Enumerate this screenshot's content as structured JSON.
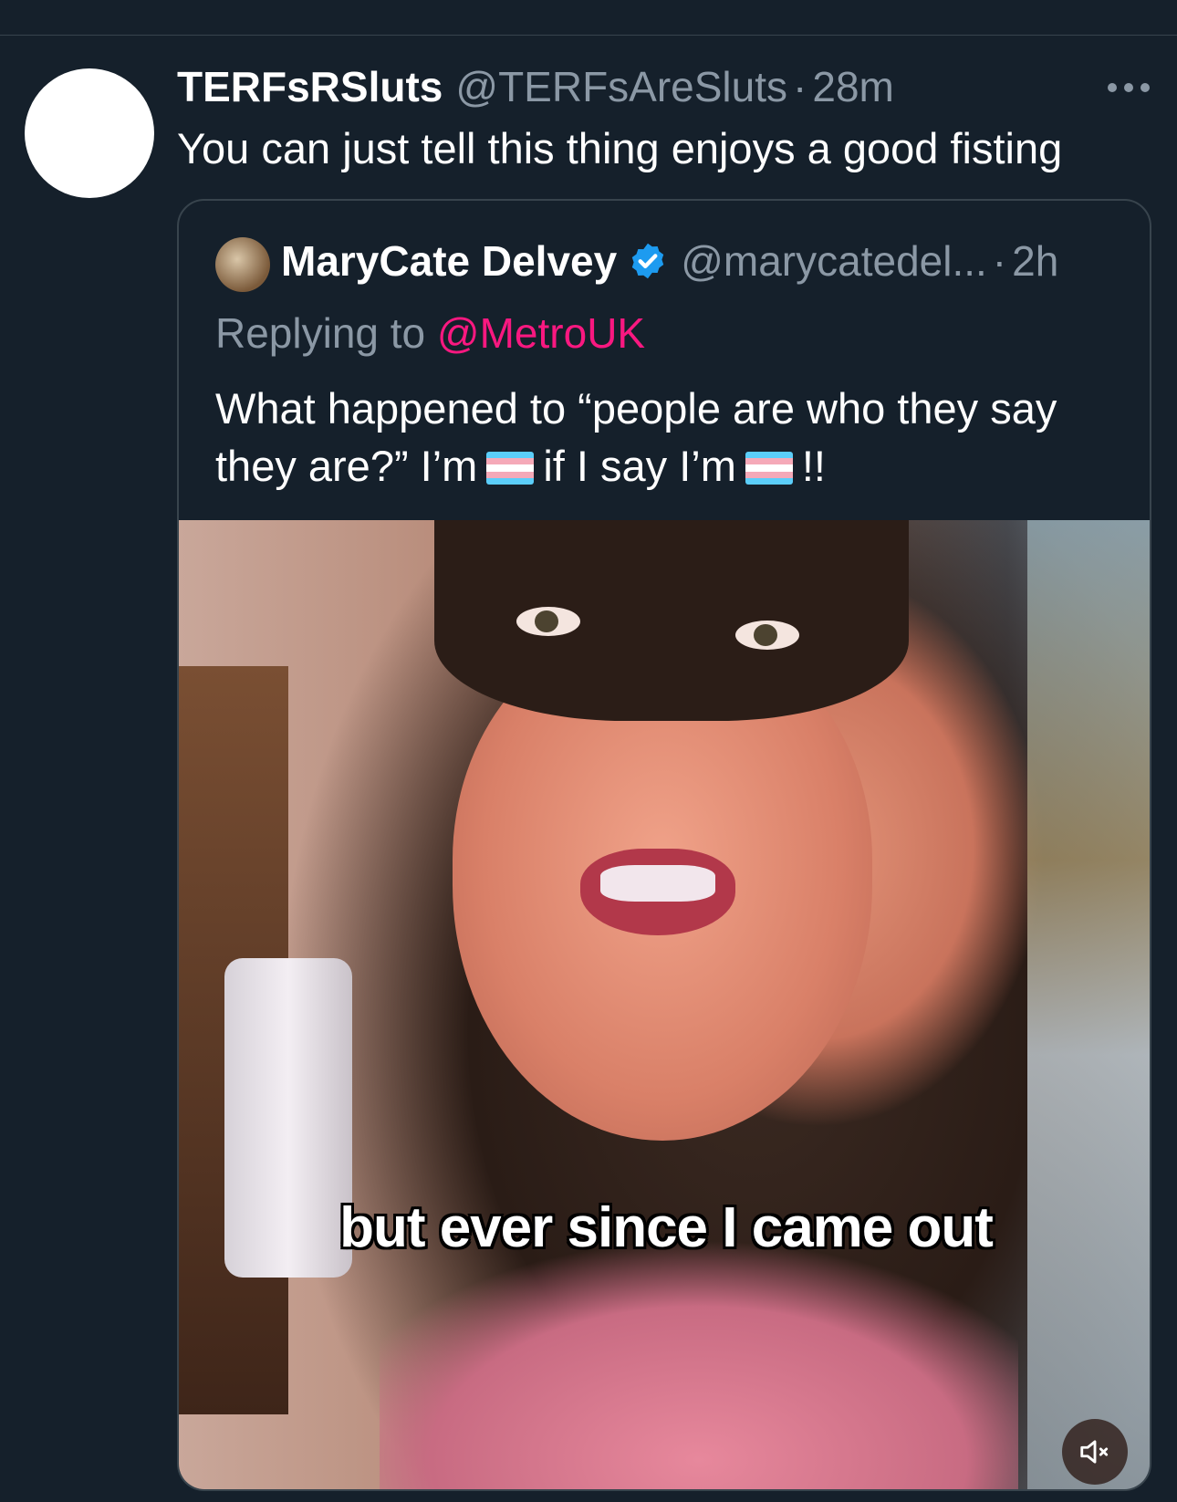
{
  "tweet": {
    "display_name": "TERFsRSluts",
    "handle": "@TERFsAreSluts",
    "separator": "·",
    "time": "28m",
    "text": "You can just tell this thing enjoys a good fisting"
  },
  "quote": {
    "display_name": "MaryCate Delvey",
    "handle": "@marycatedel...",
    "separator": "·",
    "time": "2h",
    "replying_prefix": "Replying to",
    "replying_mention": "@MetroUK",
    "text_part1": "What happened to “people are who they say they are?” I’m",
    "text_part2": "if I say I’m",
    "text_part3": "!!",
    "video_caption": "but ever since I came out"
  },
  "colors": {
    "background": "#15202b",
    "muted_text": "#8b98a5",
    "mention": "#f91880",
    "verified": "#1d9bf0",
    "flag_blue": "#5bcefa",
    "flag_pink": "#f5a9b8",
    "flag_white": "#ffffff"
  },
  "icons": {
    "more": "more-horizontal-icon",
    "verified": "verified-badge-icon",
    "flag": "transgender-flag-icon",
    "mute": "volume-muted-icon"
  }
}
